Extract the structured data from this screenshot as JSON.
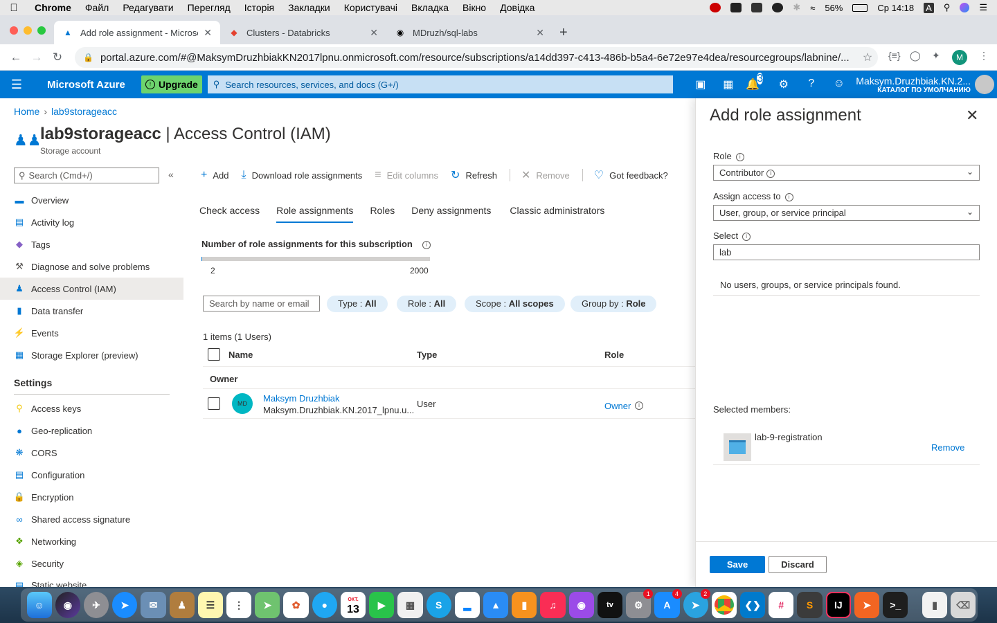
{
  "menubar": {
    "app": "Chrome",
    "items": [
      "Файл",
      "Редагувати",
      "Перегляд",
      "Історія",
      "Закладки",
      "Користувачі",
      "Вкладка",
      "Вікно",
      "Довідка"
    ],
    "battery": "56%",
    "clock": "Ср 14:18",
    "input_source": "A"
  },
  "browser": {
    "tabs": [
      {
        "title": "Add role assignment - Microso",
        "active": true
      },
      {
        "title": "Clusters - Databricks",
        "active": false
      },
      {
        "title": "MDruzh/sql-labs",
        "active": false
      }
    ],
    "url": "portal.azure.com/#@MaksymDruzhbiakKN2017lpnu.onmicrosoft.com/resource/subscriptions/a14dd397-c413-486b-b5a4-6e72e97e4dea/resourcegroups/labnine/...",
    "profile_initial": "M"
  },
  "azure": {
    "brand": "Microsoft Azure",
    "upgrade_label": "Upgrade",
    "search_placeholder": "Search resources, services, and docs (G+/)",
    "notifications_count": "3",
    "user_name": "Maksym.Druzhbiak.KN.2...",
    "user_directory": "КАТАЛОГ ПО УМОЛЧАНИЮ"
  },
  "breadcrumb": [
    "Home",
    "lab9storageacc"
  ],
  "page": {
    "resource": "lab9storageacc",
    "section": "Access Control (IAM)",
    "subtitle": "Storage account"
  },
  "sidebar": {
    "search_placeholder": "Search (Cmd+/)",
    "items": [
      {
        "label": "Overview",
        "icon": "overview-icon"
      },
      {
        "label": "Activity log",
        "icon": "activity-log-icon"
      },
      {
        "label": "Tags",
        "icon": "tag-icon"
      },
      {
        "label": "Diagnose and solve problems",
        "icon": "wrench-icon"
      },
      {
        "label": "Access Control (IAM)",
        "icon": "people-icon",
        "selected": true
      },
      {
        "label": "Data transfer",
        "icon": "data-transfer-icon"
      },
      {
        "label": "Events",
        "icon": "lightning-icon"
      },
      {
        "label": "Storage Explorer (preview)",
        "icon": "storage-explorer-icon"
      }
    ],
    "settings_header": "Settings",
    "settings_items": [
      {
        "label": "Access keys",
        "icon": "key-icon"
      },
      {
        "label": "Geo-replication",
        "icon": "globe-icon"
      },
      {
        "label": "CORS",
        "icon": "cors-icon"
      },
      {
        "label": "Configuration",
        "icon": "configuration-icon"
      },
      {
        "label": "Encryption",
        "icon": "lock-icon"
      },
      {
        "label": "Shared access signature",
        "icon": "link-icon"
      },
      {
        "label": "Networking",
        "icon": "network-icon"
      },
      {
        "label": "Security",
        "icon": "shield-icon"
      },
      {
        "label": "Static website",
        "icon": "static-website-icon"
      }
    ]
  },
  "commands": {
    "add": "Add",
    "download": "Download role assignments",
    "edit_columns": "Edit columns",
    "refresh": "Refresh",
    "remove": "Remove",
    "feedback": "Got feedback?"
  },
  "iam_tabs": [
    "Check access",
    "Role assignments",
    "Roles",
    "Deny assignments",
    "Classic administrators"
  ],
  "quota": {
    "label": "Number of role assignments for this subscription",
    "used": 2,
    "max": 2000,
    "min_label": "2",
    "max_label": "2000"
  },
  "filters": {
    "search_placeholder": "Search by name or email",
    "type_key": "Type : ",
    "type_val": "All",
    "role_key": "Role : ",
    "role_val": "All",
    "scope_key": "Scope : ",
    "scope_val": "All scopes",
    "group_key": "Group by : ",
    "group_val": "Role"
  },
  "table": {
    "count": "1 items (1 Users)",
    "headers": {
      "name": "Name",
      "type": "Type",
      "role": "Role"
    },
    "group": "Owner",
    "rows": [
      {
        "initials": "MD",
        "name": "Maksym Druzhbiak",
        "email": "Maksym.Druzhbiak.KN.2017_lpnu.u...",
        "type": "User",
        "role": "Owner"
      }
    ]
  },
  "panel": {
    "title": "Add role assignment",
    "role_label": "Role",
    "role_value": "Contributor",
    "assign_label": "Assign access to",
    "assign_value": "User, group, or service principal",
    "select_label": "Select",
    "select_value": "lab",
    "no_results": "No users, groups, or service principals found.",
    "selected_label": "Selected members:",
    "member_name": "lab-9-registration",
    "member_remove": "Remove",
    "save": "Save",
    "discard": "Discard"
  },
  "dock": {
    "calendar_month": "ОКТ.",
    "calendar_day": "13",
    "badges": {
      "system_prefs": "1",
      "app_store": "4",
      "telegram": "2"
    }
  },
  "colors": {
    "azure_blue": "#0078d4",
    "upgrade_green": "#6dd46d",
    "selected_nav": "#edebe9",
    "pill_bg": "#e1effa"
  }
}
